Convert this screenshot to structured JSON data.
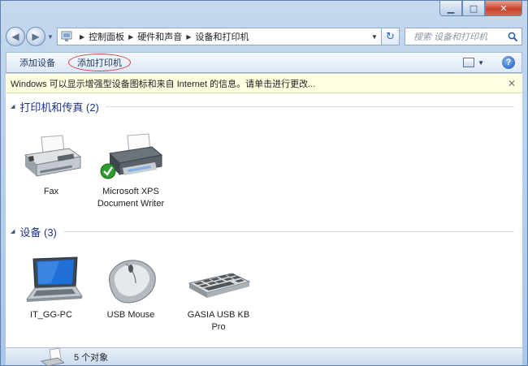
{
  "address": {
    "crumbs": [
      "控制面板",
      "硬件和声音",
      "设备和打印机"
    ]
  },
  "search": {
    "placeholder": "搜索 设备和打印机"
  },
  "toolbar": {
    "add_device": "添加设备",
    "add_printer": "添加打印机"
  },
  "infobar": {
    "message": "Windows 可以显示增强型设备图标和来自 Internet 的信息。请单击进行更改..."
  },
  "groups": {
    "printers": {
      "title": "打印机和传真 (2)",
      "items": [
        {
          "label": "Fax",
          "icon": "fax-icon"
        },
        {
          "label": "Microsoft XPS Document Writer",
          "icon": "printer-icon",
          "is_default": true
        }
      ]
    },
    "devices": {
      "title": "设备 (3)",
      "items": [
        {
          "label": "IT_GG-PC",
          "icon": "laptop-icon"
        },
        {
          "label": "USB Mouse",
          "icon": "mouse-icon"
        },
        {
          "label": "GASIA USB KB Pro",
          "icon": "keyboard-icon"
        }
      ]
    }
  },
  "status": {
    "count_text": "5 个对象"
  },
  "colors": {
    "group_title": "#1e3287",
    "info_bg": "#ffffe1",
    "annotation_circle": "#d23c3c"
  }
}
